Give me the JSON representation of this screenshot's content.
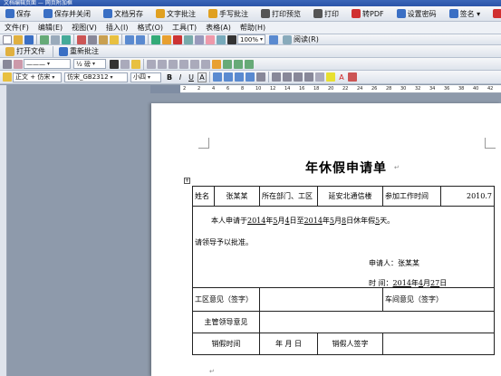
{
  "window": {
    "title": "文档编辑页面 — 网页附加框"
  },
  "toolbar1": [
    {
      "label": "保存",
      "color": "#3a6fc4"
    },
    {
      "label": "保存并关闭",
      "color": "#3a6fc4"
    },
    {
      "label": "文档另存",
      "color": "#3a6fc4"
    },
    {
      "label": "文字批注",
      "color": "#e0a020"
    },
    {
      "label": "手写批注",
      "color": "#e0a020"
    },
    {
      "label": "打印预览",
      "color": "#555555"
    },
    {
      "label": "打印",
      "color": "#555555"
    },
    {
      "label": "转PDF",
      "color": "#d03030"
    },
    {
      "label": "设置密码",
      "color": "#3a6fc4"
    },
    {
      "label": "签名 ▾",
      "color": "#3a6fc4"
    },
    {
      "label": "取消",
      "color": "#d03030"
    }
  ],
  "menubar": [
    "文件(F)",
    "编辑(E)",
    "视图(V)",
    "插入(I)",
    "格式(O)",
    "工具(T)",
    "表格(A)",
    "帮助(H)"
  ],
  "toolbar3": {
    "open_file": "打开文件",
    "re_annotate": "重新批注"
  },
  "toolbar2": {
    "zoom": "100%",
    "read": "阅读(R)"
  },
  "toolbar4": {
    "style_value": "½ 磅"
  },
  "toolbar5": {
    "style": "正文 + 仿宋",
    "font": "仿宋_GB2312",
    "size": "小四",
    "bold": "B",
    "italic": "I",
    "underline": "U",
    "color_a": "A"
  },
  "ruler": {
    "labels": [
      "6",
      "4",
      "2",
      "2",
      "4",
      "6",
      "8",
      "10",
      "12",
      "14",
      "16",
      "18",
      "20",
      "22",
      "24",
      "26",
      "28",
      "30",
      "32",
      "34",
      "36",
      "38",
      "40",
      "42"
    ]
  },
  "document": {
    "title": "年休假申请单",
    "row_name": {
      "label": "姓名",
      "value": "张某某",
      "dept_label": "所在部门、工区",
      "dept_value": "延安北通信楼",
      "work_label": "参加工作时间",
      "work_value": "2010.7"
    },
    "body": {
      "line1_pre": "本人申请于",
      "y1": "2014",
      "nian1": "年",
      "m1": "5",
      "yue1": "月",
      "d1": "4",
      "ri1": "日至",
      "y2": "2014",
      "nian2": "年",
      "m2": "5",
      "yue2": "月",
      "d2": "8",
      "ri2": "日休年假",
      "days": "5",
      "tian": "天。",
      "line2": "请领导予以批准。",
      "applicant": "申请人：张某某",
      "time_label": "时  间：",
      "t_y": "2014",
      "t_nian": "年",
      "t_m": "4",
      "t_yue": "月",
      "t_d": "27",
      "t_ri": "日"
    },
    "row_opinion": {
      "left": "工区意见（签字）",
      "right": "车间意见（签字）"
    },
    "row_leader": {
      "label": "主管领导意见"
    },
    "row_sign": {
      "label": "销假时间",
      "date": "年    月    日",
      "signer": "销假人签字"
    }
  }
}
